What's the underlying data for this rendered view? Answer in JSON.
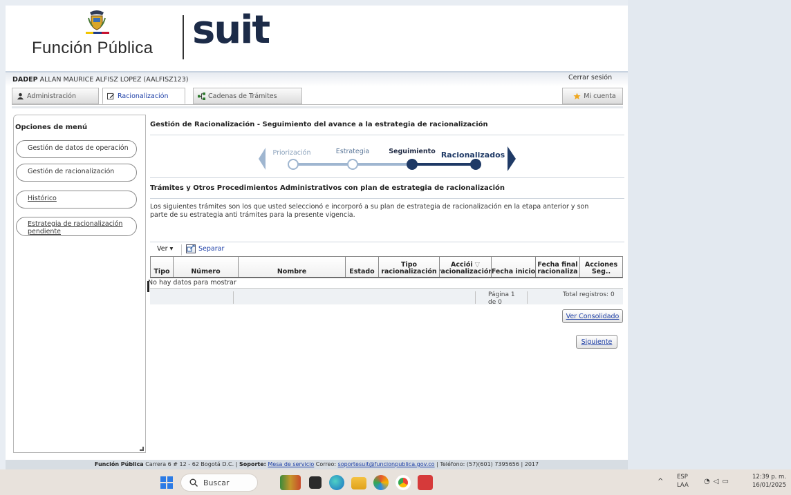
{
  "header": {
    "org_name": "Función Pública",
    "app_name": "suit"
  },
  "user_bar": {
    "entity": "DADEP",
    "user": "ALLAN MAURICE ALFISZ LOPEZ (AALFISZ123)",
    "logout": "Cerrar sesión"
  },
  "tabs": [
    {
      "label": "Administración",
      "active": false
    },
    {
      "label": "Racionalización",
      "active": true
    },
    {
      "label": "Cadenas de Trámites",
      "active": false
    }
  ],
  "account_tab": "Mi cuenta",
  "sidebar": {
    "title": "Opciones de menú",
    "items": [
      {
        "label": "Gestión de datos de operación"
      },
      {
        "label": "Gestión de racionalización"
      },
      {
        "label": "Histórico"
      },
      {
        "label": "Estrategia de racionalización pendiente"
      }
    ]
  },
  "main": {
    "title": "Gestión de Racionalización - Seguimiento del avance a la estrategia de racionalización",
    "stepper": {
      "steps": [
        "Priorización",
        "Estrategia",
        "Seguimiento",
        "Racionalizados"
      ],
      "current": "Seguimiento"
    },
    "section_title": "Trámites y Otros Procedimientos Administrativos con plan de estrategia de racionalización",
    "section_desc": "Los siguientes trámites son los que usted seleccionó e incorporó a su plan de estrategia de racionalización en la etapa anterior y son parte de su estrategia anti trámites para la presente vigencia."
  },
  "grid": {
    "view_menu": "Ver",
    "detach": "Separar",
    "columns": [
      {
        "line1": "",
        "line2": "Tipo"
      },
      {
        "line1": "",
        "line2": "Número"
      },
      {
        "line1": "",
        "line2": "Nombre"
      },
      {
        "line1": "",
        "line2": "Estado"
      },
      {
        "line1": "Tipo",
        "line2": "racionalización"
      },
      {
        "line1": "Acciói",
        "line2": "racionalización"
      },
      {
        "line1": "",
        "line2": "Fecha inicio"
      },
      {
        "line1": "Fecha final",
        "line2": "racionaliza"
      },
      {
        "line1": "Acciones",
        "line2": "Seg.."
      }
    ],
    "empty_text": "No hay datos para mostrar",
    "pager": "Página 1 de 0",
    "total": "Total registros: 0"
  },
  "buttons": {
    "consolidado": "Ver Consolidado",
    "siguiente": "Siguiente"
  },
  "footer": {
    "org": "Función Pública",
    "address": "Carrera 6 # 12 - 62 Bogotá D.C. |",
    "support_label": "Soporte:",
    "support_link": "Mesa de servicio",
    "mail_label": "Correo:",
    "mail_link": "soportesuit@funcionpublica.gov.co",
    "phone": "| Teléfono: (57)(601) 7395656 | 2017"
  },
  "taskbar": {
    "search_placeholder": "Buscar",
    "lang_line1": "ESP",
    "lang_line2": "LAA",
    "time": "12:39 p. m.",
    "date": "16/01/2025"
  },
  "colors": {
    "brand_navy": "#1c2b48",
    "link_blue": "#1c3ea6",
    "step_dark": "#1f3a66",
    "step_light": "#9fb6d0"
  }
}
